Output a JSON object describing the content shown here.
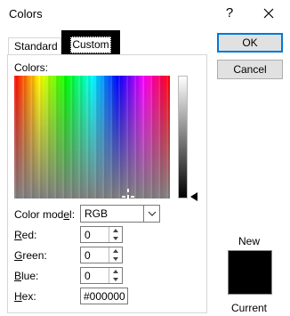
{
  "window": {
    "title": "Colors",
    "help_glyph": "?",
    "close_glyph": "✕"
  },
  "tabs": [
    {
      "label": "Standard",
      "selected": false
    },
    {
      "label": "Custom",
      "selected": true
    }
  ],
  "colors_section": {
    "label": "Colors:"
  },
  "color_model": {
    "label_pre": "Color mod",
    "label_accel": "e",
    "label_post": "l:",
    "value": "RGB"
  },
  "fields": {
    "red": {
      "accel": "R",
      "rest": "ed:",
      "value": "0"
    },
    "green": {
      "accel": "G",
      "rest": "reen:",
      "value": "0"
    },
    "blue": {
      "accel": "B",
      "rest": "lue:",
      "value": "0"
    },
    "hex": {
      "accel": "H",
      "rest": "ex:",
      "value": "#000000"
    }
  },
  "buttons": {
    "ok": "OK",
    "cancel": "Cancel"
  },
  "preview": {
    "new_label": "New",
    "current_label": "Current",
    "new_color": "#000000"
  },
  "icons": {
    "close": "close-icon",
    "help": "help-icon",
    "dropdown": "chevron-down-icon",
    "spin_up": "spin-up-icon",
    "spin_down": "spin-down-icon",
    "luminance_marker": "triangle-left-icon"
  }
}
